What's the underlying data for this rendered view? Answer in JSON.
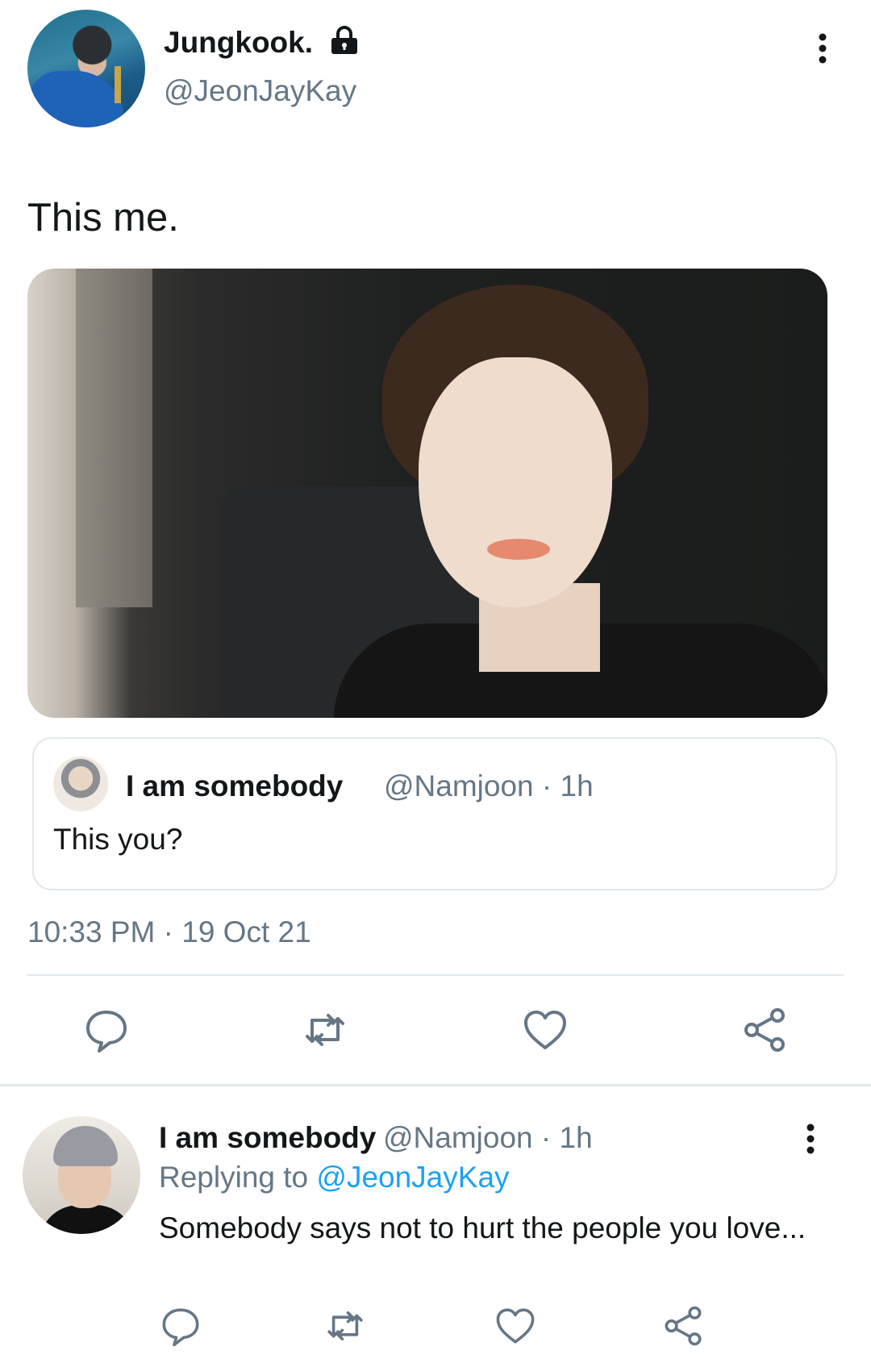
{
  "author": {
    "display_name": "Jungkook.",
    "handle": "@JeonJayKay",
    "protected_icon": "lock-icon"
  },
  "tweet": {
    "text": "This me.",
    "timestamp": "10:33 PM · 19 Oct 21"
  },
  "quoted_tweet": {
    "display_name": "I am somebody",
    "meta": "@Namjoon · 1h",
    "text": "This you?"
  },
  "actions": [
    "reply-icon",
    "retweet-icon",
    "like-icon",
    "share-icon"
  ],
  "reply": {
    "display_name": "I am somebody",
    "meta": "@Namjoon · 1h",
    "replying_prefix": "Replying to",
    "replying_to": "@JeonJayKay",
    "text": "Somebody says not to hurt the people you love..."
  },
  "colors": {
    "primary_text": "#14171a",
    "secondary_text": "#657786",
    "link": "#1da1f2",
    "icon": "#657786",
    "border": "#e1e8ed"
  }
}
